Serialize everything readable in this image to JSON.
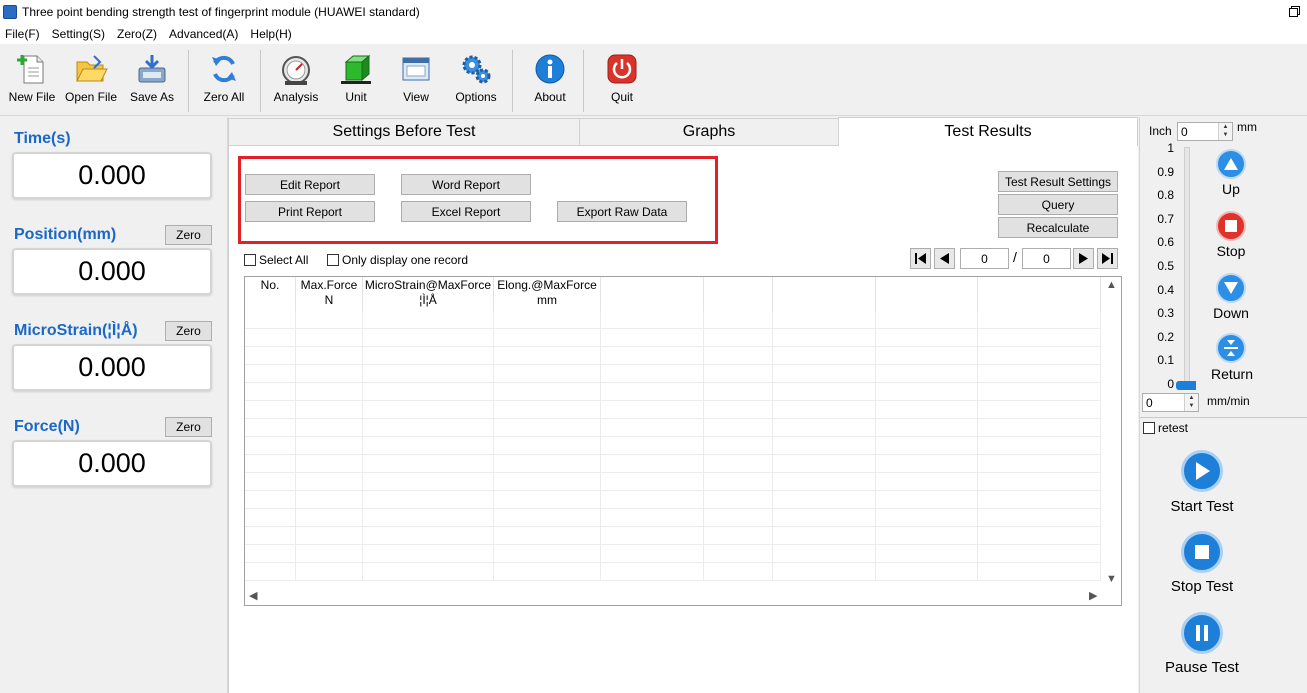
{
  "window": {
    "title": "Three point bending strength test of fingerprint module (HUAWEI standard)"
  },
  "menu": [
    "File(F)",
    "Setting(S)",
    "Zero(Z)",
    "Advanced(A)",
    "Help(H)"
  ],
  "toolbar": {
    "new_file": "New File",
    "open_file": "Open File",
    "save_as": "Save As",
    "zero_all": "Zero All",
    "analysis": "Analysis",
    "unit": "Unit",
    "view": "View",
    "options": "Options",
    "about": "About",
    "quit": "Quit"
  },
  "meters": {
    "time": {
      "label": "Time(s)",
      "value": "0.000"
    },
    "position": {
      "label": "Position(mm)",
      "value": "0.000",
      "zero": "Zero"
    },
    "microstrain": {
      "label": "MicroStrain(¦Ì¦Å)",
      "value": "0.000",
      "zero": "Zero"
    },
    "force": {
      "label": "Force(N)",
      "value": "0.000",
      "zero": "Zero"
    }
  },
  "tabs": [
    "Settings Before Test",
    "Graphs",
    "Test Results"
  ],
  "active_tab": "Test Results",
  "report": {
    "edit_report": "Edit Report",
    "word_report": "Word Report",
    "print_report": "Print Report",
    "excel_report": "Excel Report",
    "export_raw": "Export Raw Data"
  },
  "side_buttons": {
    "result_settings": "Test Result Settings",
    "query": "Query",
    "recalculate": "Recalculate"
  },
  "options": {
    "select_all": "Select All",
    "only_one": "Only display one record"
  },
  "pager": {
    "current": "0",
    "separator": "/",
    "total": "0"
  },
  "grid": {
    "headers": [
      {
        "line1": "No.",
        "line2": ""
      },
      {
        "line1": "Max.Force",
        "line2": "N"
      },
      {
        "line1": "MicroStrain@MaxForce",
        "line2": "¦Ì¦Å"
      },
      {
        "line1": "Elong.@MaxForce",
        "line2": "mm"
      }
    ]
  },
  "speed_panel": {
    "inch_label": "Inch",
    "inch_value": "0",
    "inch_unit": "mm",
    "scale": [
      "1",
      "0.9",
      "0.8",
      "0.7",
      "0.6",
      "0.5",
      "0.4",
      "0.3",
      "0.2",
      "0.1",
      "0"
    ],
    "slider_value": 0,
    "speed_value": "0",
    "speed_unit": "mm/min",
    "up": "Up",
    "stop": "Stop",
    "down": "Down",
    "return": "Return",
    "retest": "retest",
    "start_test": "Start Test",
    "stop_test": "Stop Test",
    "pause_test": "Pause Test"
  },
  "colors": {
    "accent_blue": "#1a68c8",
    "highlight_red": "#e0202a",
    "button_blue": "#1e7fd8",
    "stop_red": "#e0322c"
  }
}
